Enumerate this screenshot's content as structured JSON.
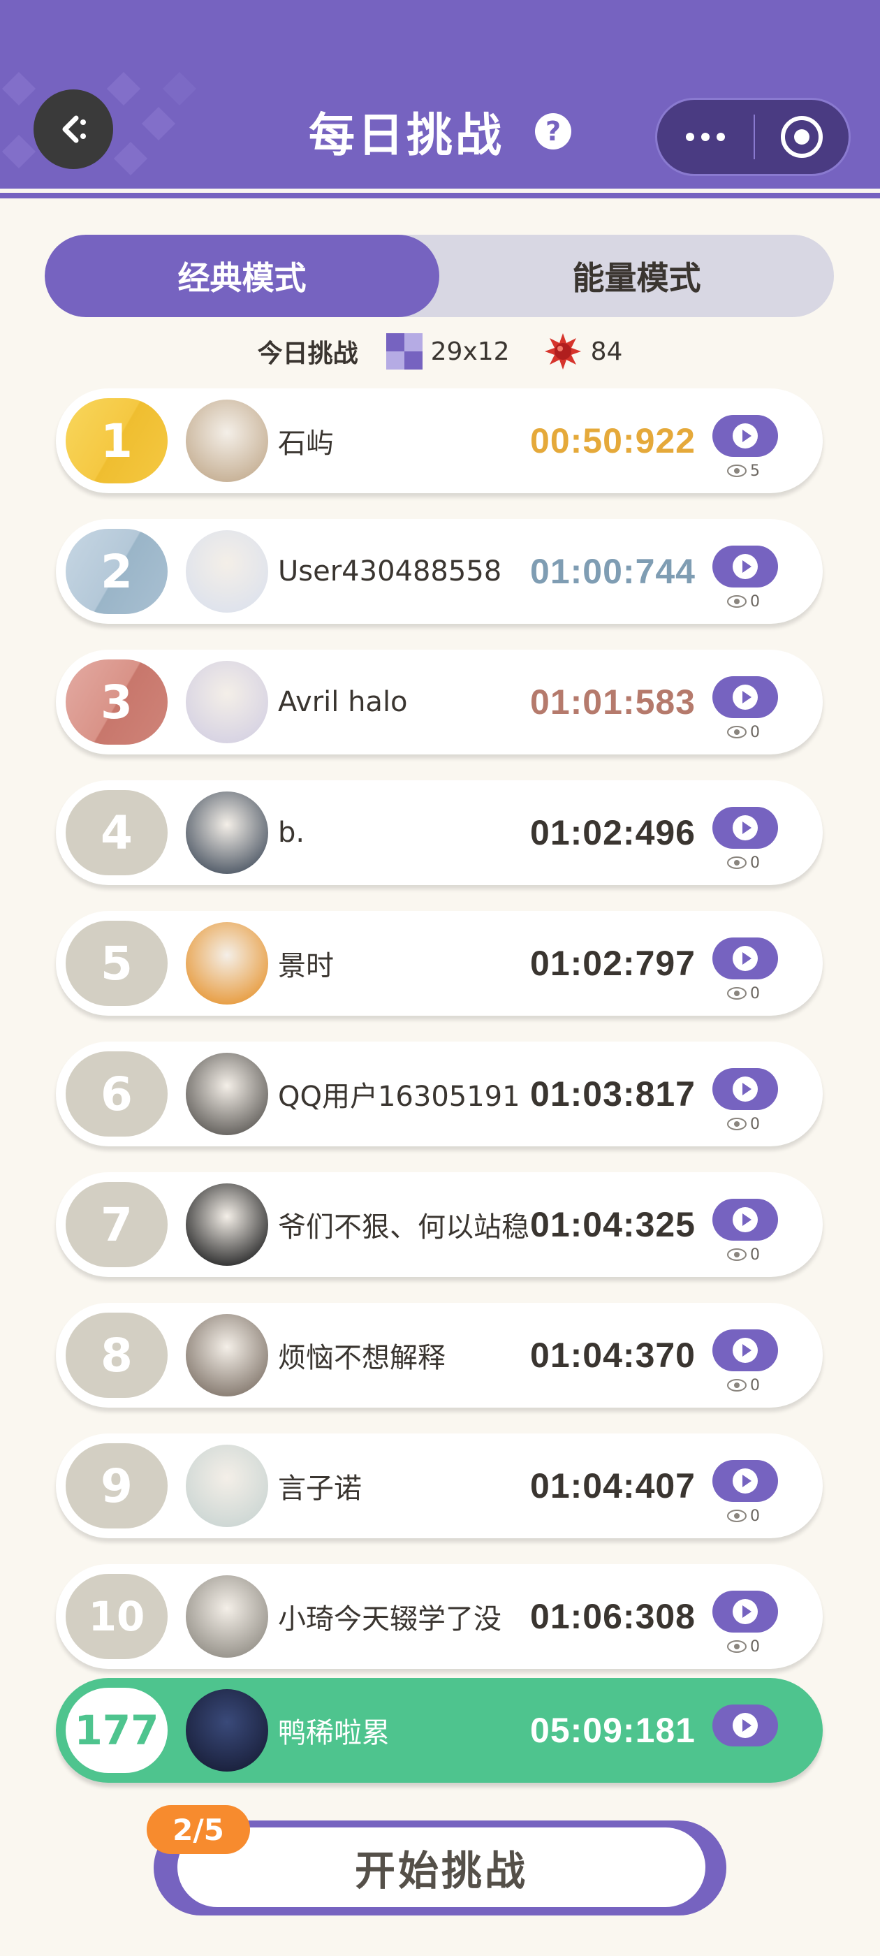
{
  "header": {
    "title": "每日挑战"
  },
  "tabs": [
    {
      "label": "经典模式",
      "active": true
    },
    {
      "label": "能量模式",
      "active": false
    }
  ],
  "challenge": {
    "label": "今日挑战",
    "board_size": "29x12",
    "mines": "84"
  },
  "leaderboard": [
    {
      "rank": "1",
      "name": "石屿",
      "time": "00:50:922",
      "views": "5",
      "time_color": "#e5a93a"
    },
    {
      "rank": "2",
      "name": "User430488558",
      "time": "01:00:744",
      "views": "0",
      "time_color": "#7f9db3"
    },
    {
      "rank": "3",
      "name": "Avril halo",
      "time": "01:01:583",
      "views": "0",
      "time_color": "#b57a6c"
    },
    {
      "rank": "4",
      "name": "b.",
      "time": "01:02:496",
      "views": "0"
    },
    {
      "rank": "5",
      "name": "景时",
      "time": "01:02:797",
      "views": "0"
    },
    {
      "rank": "6",
      "name": "QQ用户16305191",
      "time": "01:03:817",
      "views": "0"
    },
    {
      "rank": "7",
      "name": "爷们不狠、何以站稳",
      "time": "01:04:325",
      "views": "0"
    },
    {
      "rank": "8",
      "name": "烦恼不想解释",
      "time": "01:04:370",
      "views": "0"
    },
    {
      "rank": "9",
      "name": "言子诺",
      "time": "01:04:407",
      "views": "0"
    },
    {
      "rank": "10",
      "name": "小琦今天辍学了没",
      "time": "01:06:308",
      "views": "0"
    }
  ],
  "my_entry": {
    "rank": "177",
    "name": "鸭稀啦累",
    "time": "05:09:181"
  },
  "start": {
    "label": "开始挑战",
    "attempts": "2/5"
  },
  "colors": {
    "accent": "#7663c0",
    "highlight": "#4ec48e",
    "badge": "#f78b2e"
  }
}
